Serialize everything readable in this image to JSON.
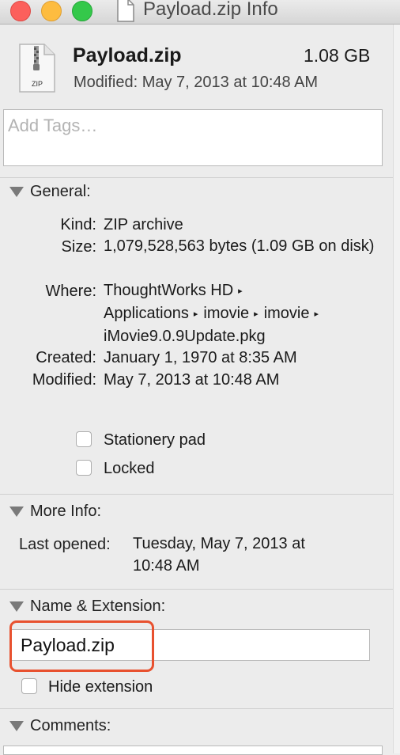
{
  "window": {
    "title": "Payload.zip Info"
  },
  "header": {
    "file_name": "Payload.zip",
    "file_size": "1.08 GB",
    "modified_line": "Modified: May 7, 2013 at 10:48 AM",
    "file_icon_label": "ZIP"
  },
  "tags": {
    "placeholder": "Add Tags…"
  },
  "general": {
    "title": "General:",
    "kind_key": "Kind:",
    "kind_val": "ZIP archive",
    "size_key": "Size:",
    "size_val": "1,079,528,563 bytes (1.09 GB on disk)",
    "where_key": "Where:",
    "where_path": [
      "ThoughtWorks HD",
      "Applications",
      "imovie",
      "imovie",
      "iMovie9.0.9Update.pkg"
    ],
    "created_key": "Created:",
    "created_val": "January 1, 1970 at 8:35 AM",
    "modified_key": "Modified:",
    "modified_val": "May 7, 2013 at 10:48 AM",
    "stationery_label": "Stationery pad",
    "stationery_checked": false,
    "locked_label": "Locked",
    "locked_checked": false
  },
  "more_info": {
    "title": "More Info:",
    "last_opened_key": "Last opened:",
    "last_opened_val": "Tuesday, May 7, 2013 at 10:48 AM"
  },
  "name_ext": {
    "title": "Name & Extension:",
    "name_value": "Payload.zip",
    "hide_ext_label": "Hide extension",
    "hide_ext_checked": false
  },
  "comments": {
    "title": "Comments:"
  },
  "colors": {
    "highlight": "#e8512f"
  },
  "icons": [
    "file-icon",
    "zip-file-icon",
    "disclosure-triangle-icon",
    "path-arrow-icon"
  ]
}
